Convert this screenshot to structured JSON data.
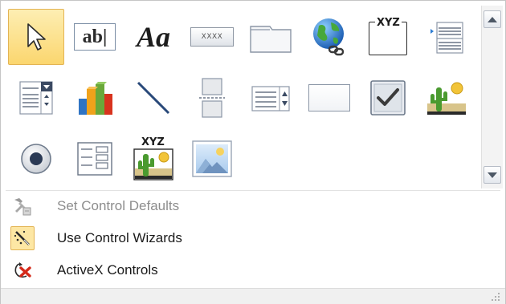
{
  "gallery": {
    "rows": [
      [
        "select-pointer-icon",
        "text-box-icon",
        "label-icon",
        "button-icon",
        "tab-control-icon",
        "hyperlink-icon",
        "web-browser-control-icon",
        "navigation-control-icon"
      ],
      [
        "combo-box-icon",
        "chart-icon",
        "line-icon",
        "page-break-icon",
        "list-box-icon",
        "rectangle-icon",
        "check-box-icon",
        "unbound-object-frame-icon"
      ],
      [
        "option-button-icon",
        "subform-icon",
        "bound-object-frame-icon",
        "image-icon"
      ]
    ],
    "selected": "select-pointer-icon",
    "text_box_text": "ab|",
    "label_text": "Aa",
    "button_text": "XXXX",
    "web_browser_text": "XYZ",
    "bound_object_text": "XYZ"
  },
  "menu": [
    {
      "label": "Set Control Defaults",
      "icon": "control-defaults-icon",
      "enabled": false
    },
    {
      "label": "Use Control Wizards",
      "icon": "control-wizards-icon",
      "enabled": true,
      "checked": true
    },
    {
      "label": "ActiveX Controls",
      "icon": "activex-controls-icon",
      "enabled": true
    }
  ]
}
